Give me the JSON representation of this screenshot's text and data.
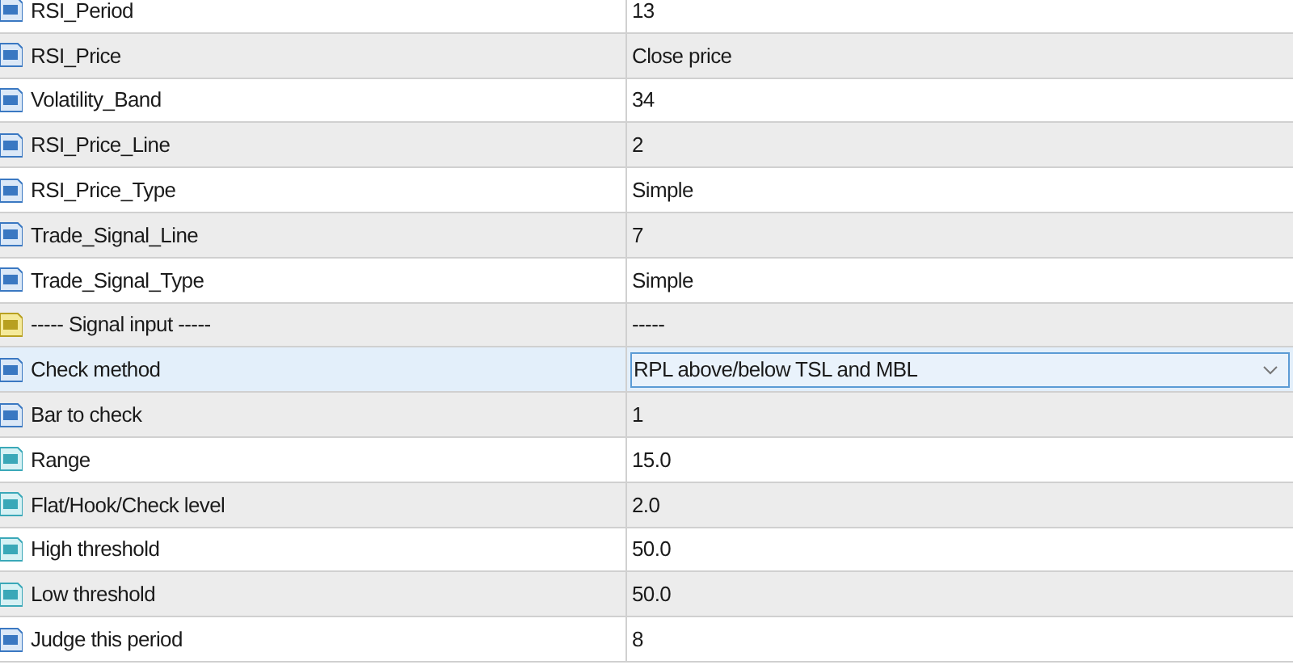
{
  "rows": [
    {
      "kind": "int",
      "name": "RSI_Period",
      "value": "13",
      "selected": false
    },
    {
      "kind": "int",
      "name": "RSI_Price",
      "value": "Close price",
      "selected": false
    },
    {
      "kind": "int",
      "name": "Volatility_Band",
      "value": "34",
      "selected": false
    },
    {
      "kind": "int",
      "name": "RSI_Price_Line",
      "value": "2",
      "selected": false
    },
    {
      "kind": "int",
      "name": "RSI_Price_Type",
      "value": "Simple",
      "selected": false
    },
    {
      "kind": "int",
      "name": "Trade_Signal_Line",
      "value": "7",
      "selected": false
    },
    {
      "kind": "int",
      "name": "Trade_Signal_Type",
      "value": "Simple",
      "selected": false
    },
    {
      "kind": "string",
      "name": "----- Signal input -----",
      "value": "-----",
      "selected": false
    },
    {
      "kind": "int",
      "name": "Check method",
      "value": "RPL above/below TSL and MBL",
      "selected": true
    },
    {
      "kind": "int",
      "name": "Bar to check",
      "value": "1",
      "selected": false
    },
    {
      "kind": "double",
      "name": "Range",
      "value": "15.0",
      "selected": false
    },
    {
      "kind": "double",
      "name": "Flat/Hook/Check level",
      "value": "2.0",
      "selected": false
    },
    {
      "kind": "double",
      "name": "High threshold",
      "value": "50.0",
      "selected": false
    },
    {
      "kind": "double",
      "name": "Low threshold",
      "value": "50.0",
      "selected": false
    },
    {
      "kind": "int",
      "name": "Judge this period",
      "value": "8",
      "selected": false
    }
  ]
}
